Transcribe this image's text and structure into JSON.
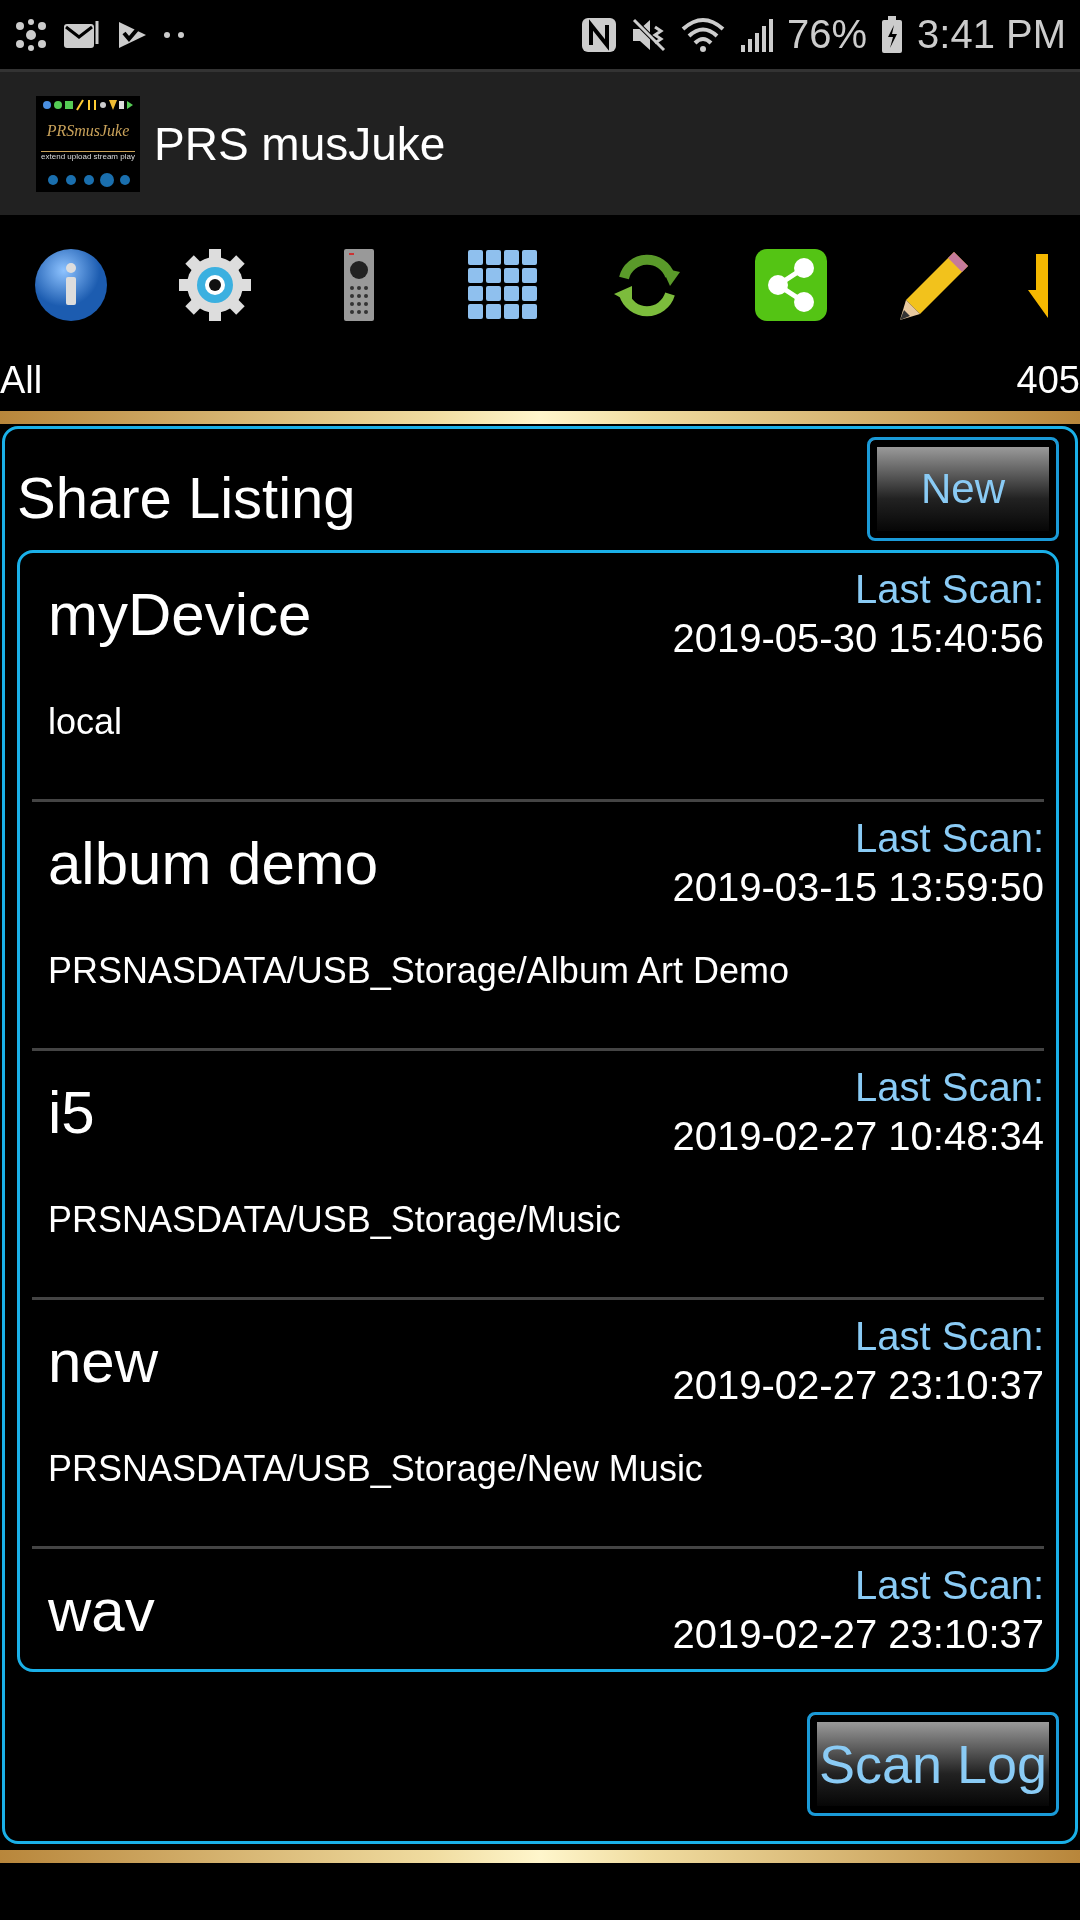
{
  "status_bar": {
    "battery": "76%",
    "time": "3:41 PM"
  },
  "app_bar": {
    "title": "PRS musJuke",
    "logo": {
      "text": "PRSmusJuke",
      "tagline": "extend upload stream play"
    }
  },
  "toolbar": {
    "icons": [
      {
        "kind": "info"
      },
      {
        "kind": "settings"
      },
      {
        "kind": "remote"
      },
      {
        "kind": "grid"
      },
      {
        "kind": "refresh"
      },
      {
        "kind": "share"
      },
      {
        "kind": "edit"
      },
      {
        "kind": "download"
      }
    ]
  },
  "filter": {
    "label": "All",
    "count": "405"
  },
  "panel": {
    "title": "Share Listing",
    "new_button": "New",
    "scan_log_button": "Scan Log",
    "shares": [
      {
        "name": "myDevice",
        "scan_label": "Last Scan:",
        "scan_time": "2019-05-30 15:40:56",
        "path": "local"
      },
      {
        "name": "album demo",
        "scan_label": "Last Scan:",
        "scan_time": "2019-03-15 13:59:50",
        "path": "PRSNASDATA/USB_Storage/Album Art Demo"
      },
      {
        "name": "i5",
        "scan_label": "Last Scan:",
        "scan_time": "2019-02-27 10:48:34",
        "path": "PRSNASDATA/USB_Storage/Music"
      },
      {
        "name": "new",
        "scan_label": "Last Scan:",
        "scan_time": "2019-02-27 23:10:37",
        "path": "PRSNASDATA/USB_Storage/New Music"
      },
      {
        "name": "wav",
        "scan_label": "Last Scan:",
        "scan_time": "2019-02-27 23:10:37"
      }
    ]
  }
}
